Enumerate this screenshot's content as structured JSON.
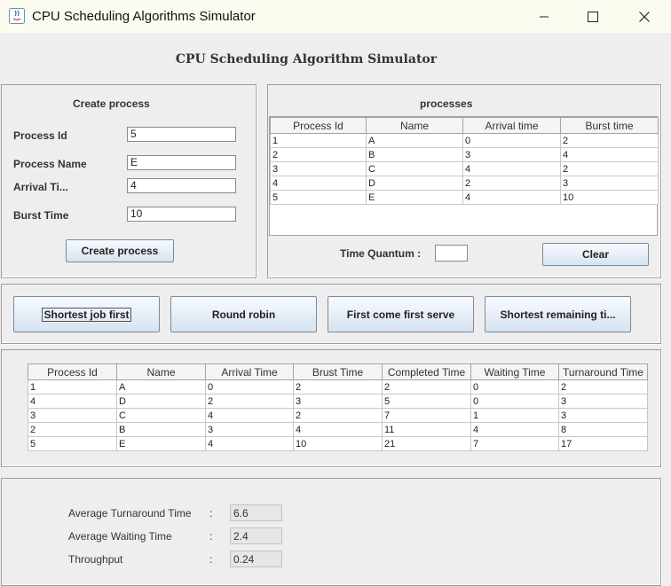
{
  "window": {
    "title": "CPU Scheduling Algorithms Simulator"
  },
  "heading": "CPU Scheduling Algorithm Simulator",
  "create_panel": {
    "title": "Create process",
    "fields": [
      {
        "label": "Process Id",
        "value": "5"
      },
      {
        "label": "Process Name",
        "value": "E"
      },
      {
        "label": "Arrival Ti...",
        "value": "4"
      },
      {
        "label": "Burst Time",
        "value": "10"
      }
    ],
    "button": "Create process"
  },
  "processes_panel": {
    "title": "processes",
    "columns": [
      "Process Id",
      "Name",
      "Arrival time",
      "Burst time"
    ],
    "rows": [
      [
        "1",
        "A",
        "0",
        "2"
      ],
      [
        "2",
        "B",
        "3",
        "4"
      ],
      [
        "3",
        "C",
        "4",
        "2"
      ],
      [
        "4",
        "D",
        "2",
        "3"
      ],
      [
        "5",
        "E",
        "4",
        "10"
      ]
    ],
    "quantum_label": "Time Quantum :",
    "quantum_value": "",
    "clear_button": "Clear"
  },
  "algorithms": [
    "Shortest job first",
    "Round robin",
    "First come first serve",
    "Shortest remaining ti..."
  ],
  "results": {
    "columns": [
      "Process Id",
      "Name",
      "Arrival Time",
      "Brust Time",
      "Completed Time",
      "Waiting Time",
      "Turnaround Time"
    ],
    "rows": [
      [
        "1",
        "A",
        "0",
        "2",
        "2",
        "0",
        "2"
      ],
      [
        "4",
        "D",
        "2",
        "3",
        "5",
        "0",
        "3"
      ],
      [
        "3",
        "C",
        "4",
        "2",
        "7",
        "1",
        "3"
      ],
      [
        "2",
        "B",
        "3",
        "4",
        "11",
        "4",
        "8"
      ],
      [
        "5",
        "E",
        "4",
        "10",
        "21",
        "7",
        "17"
      ]
    ]
  },
  "stats": [
    {
      "label": "Average Turnaround Time",
      "colon": ":",
      "value": "6.6"
    },
    {
      "label": "Average Waiting Time",
      "colon": ":",
      "value": "2.4"
    },
    {
      "label": "Throughput",
      "colon": ":",
      "value": "0.24"
    }
  ]
}
